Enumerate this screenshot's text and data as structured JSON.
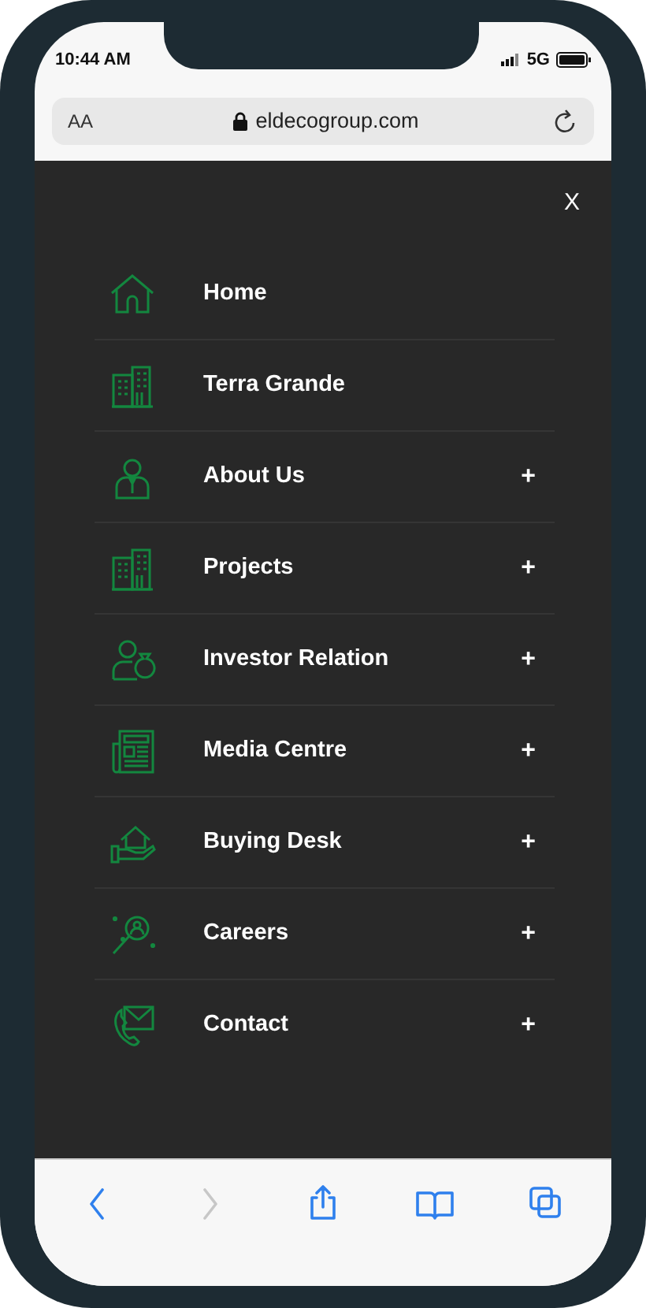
{
  "status_bar": {
    "time": "10:44 AM",
    "network": "5G"
  },
  "address_bar": {
    "text_size": "AA",
    "url": "eldecogroup.com"
  },
  "menu": {
    "close": "X",
    "items": [
      {
        "label": "Home",
        "kind": "home",
        "expandable": false
      },
      {
        "label": "Terra Grande",
        "kind": "buildings",
        "expandable": false
      },
      {
        "label": "About Us",
        "kind": "person",
        "expandable": true
      },
      {
        "label": "Projects",
        "kind": "buildings",
        "expandable": true
      },
      {
        "label": "Investor Relation",
        "kind": "investor",
        "expandable": true
      },
      {
        "label": "Media Centre",
        "kind": "newspaper",
        "expandable": true
      },
      {
        "label": "Buying Desk",
        "kind": "househand",
        "expandable": true
      },
      {
        "label": "Careers",
        "kind": "magnifier",
        "expandable": true
      },
      {
        "label": "Contact",
        "kind": "contact",
        "expandable": true
      }
    ],
    "expand_symbol": "+"
  },
  "toolbar": [
    {
      "kind": "back",
      "disabled": false
    },
    {
      "kind": "forward",
      "disabled": true
    },
    {
      "kind": "share",
      "disabled": false
    },
    {
      "kind": "bookmarks",
      "disabled": false
    },
    {
      "kind": "tabs",
      "disabled": false
    }
  ]
}
